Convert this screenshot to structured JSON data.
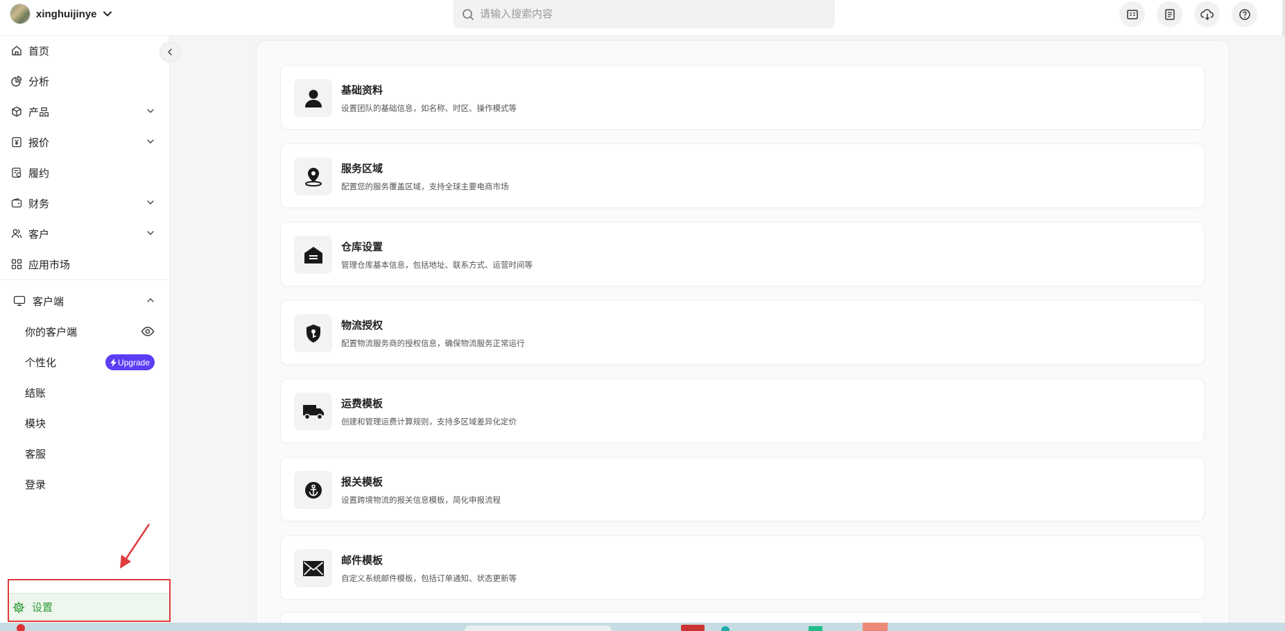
{
  "header": {
    "team_name": "xinghuijinye",
    "search_placeholder": "请输入搜索内容",
    "icons": [
      "report-icon",
      "document-icon",
      "cloud-download-icon",
      "help-icon"
    ]
  },
  "sidebar": {
    "items": [
      {
        "label": "首页",
        "icon": "home-icon"
      },
      {
        "label": "分析",
        "icon": "chart-pie-icon"
      },
      {
        "label": "产品",
        "icon": "box-icon",
        "expandable": true
      },
      {
        "label": "报价",
        "icon": "yuan-icon",
        "expandable": true
      },
      {
        "label": "履约",
        "icon": "fulfill-icon"
      },
      {
        "label": "财务",
        "icon": "wallet-icon",
        "expandable": true
      },
      {
        "label": "客户",
        "icon": "users-icon",
        "expandable": true
      },
      {
        "label": "应用市场",
        "icon": "apps-icon"
      }
    ],
    "client_section": {
      "label": "客户端",
      "icon": "monitor-icon",
      "sub_items": [
        {
          "label": "你的客户端",
          "badge": "eye-icon"
        },
        {
          "label": "个性化",
          "badge": "Upgrade"
        },
        {
          "label": "结账"
        },
        {
          "label": "模块"
        },
        {
          "label": "客服"
        },
        {
          "label": "登录"
        }
      ]
    },
    "settings_label": "设置"
  },
  "cards": [
    {
      "title": "基础资料",
      "desc": "设置团队的基础信息，如名称、时区、操作模式等",
      "icon": "user-icon"
    },
    {
      "title": "服务区域",
      "desc": "配置您的服务覆盖区域，支持全球主要电商市场",
      "icon": "location-icon"
    },
    {
      "title": "仓库设置",
      "desc": "管理仓库基本信息，包括地址、联系方式、运营时间等",
      "icon": "warehouse-icon"
    },
    {
      "title": "物流授权",
      "desc": "配置物流服务商的授权信息，确保物流服务正常运行",
      "icon": "shield-key-icon"
    },
    {
      "title": "运费模板",
      "desc": "创建和管理运费计算规则，支持多区域差异化定价",
      "icon": "truck-icon"
    },
    {
      "title": "报关模板",
      "desc": "设置跨境物流的报关信息模板，简化申报流程",
      "icon": "anchor-icon"
    },
    {
      "title": "邮件模板",
      "desc": "自定义系统邮件模板，包括订单通知、状态更新等",
      "icon": "mail-icon"
    }
  ],
  "colors": {
    "upgrade": "#5b3df5",
    "settings_active": "#2e9b3a",
    "annotation": "#e03a3a"
  }
}
